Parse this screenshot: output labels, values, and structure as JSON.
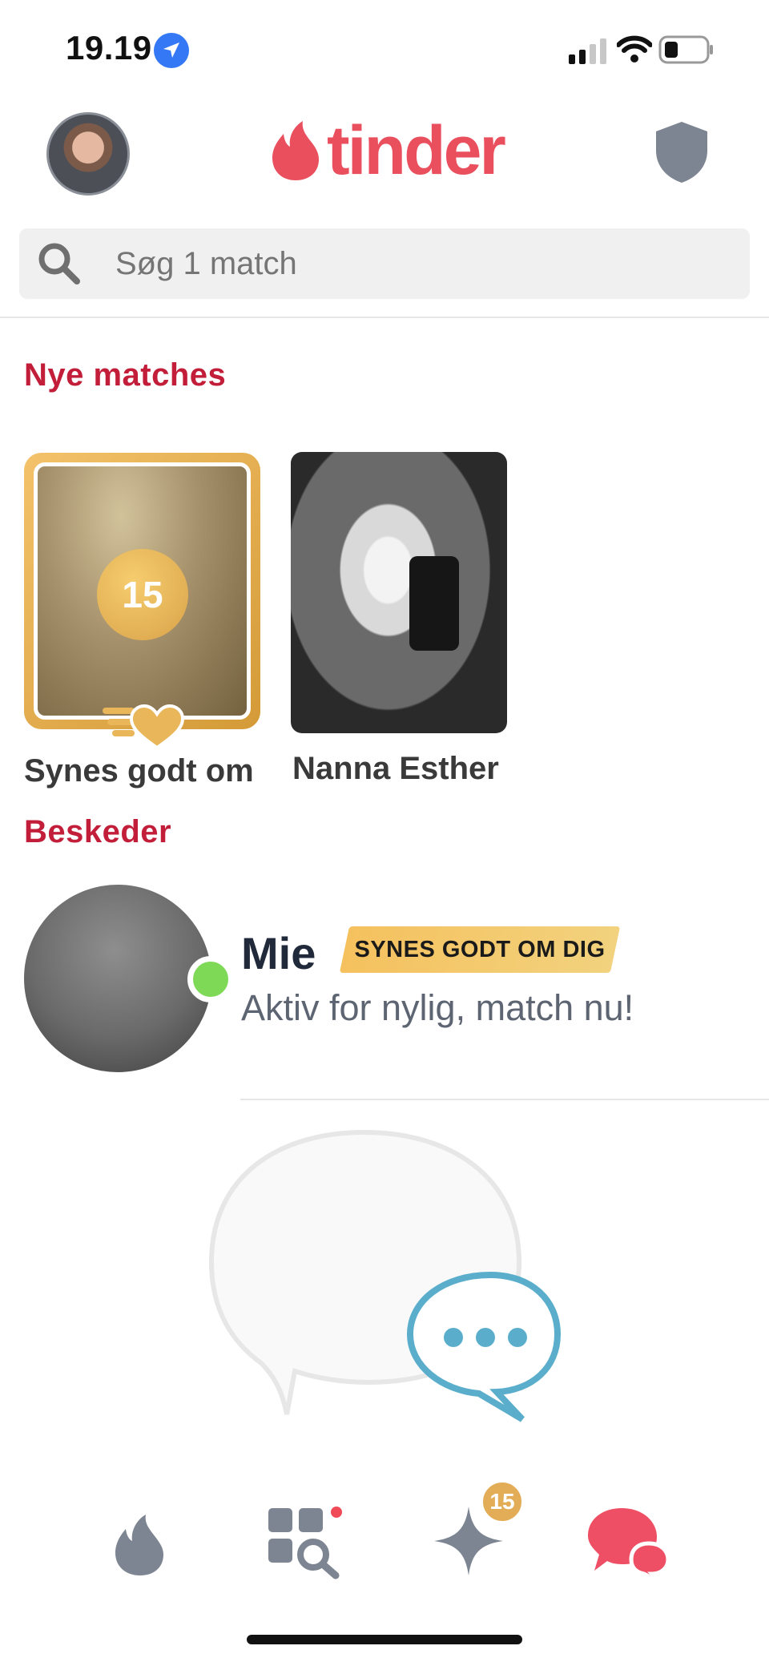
{
  "status_bar": {
    "time": "19.19",
    "icons": [
      "location-arrow-icon",
      "cellular-signal-icon",
      "wifi-icon",
      "battery-icon"
    ]
  },
  "header": {
    "logo_text": "tinder",
    "left": "profile-avatar",
    "right": "safety-shield-icon"
  },
  "search": {
    "placeholder": "Søg 1 match"
  },
  "new_matches": {
    "title": "Nye matches",
    "items": [
      {
        "label": "Synes godt om",
        "count": "15",
        "type": "likes"
      },
      {
        "label": "Nanna Esther",
        "type": "photo"
      }
    ]
  },
  "messages": {
    "title": "Beskeder",
    "items": [
      {
        "name": "Mie",
        "tag": "SYNES GODT OM DIG",
        "preview": "Aktiv for nylig, match nu!",
        "online": true
      }
    ]
  },
  "bottom_nav": {
    "items": [
      {
        "icon": "flame-icon"
      },
      {
        "icon": "explore-icon"
      },
      {
        "icon": "sparkle-icon",
        "badge": "15"
      },
      {
        "icon": "chat-icon",
        "active": true
      }
    ]
  },
  "colors": {
    "brand": "#ea4f5e",
    "section_title": "#c21e3a",
    "gold": "#e2ad56",
    "online": "#7ed957",
    "chat_accent": "#5aaecb"
  }
}
